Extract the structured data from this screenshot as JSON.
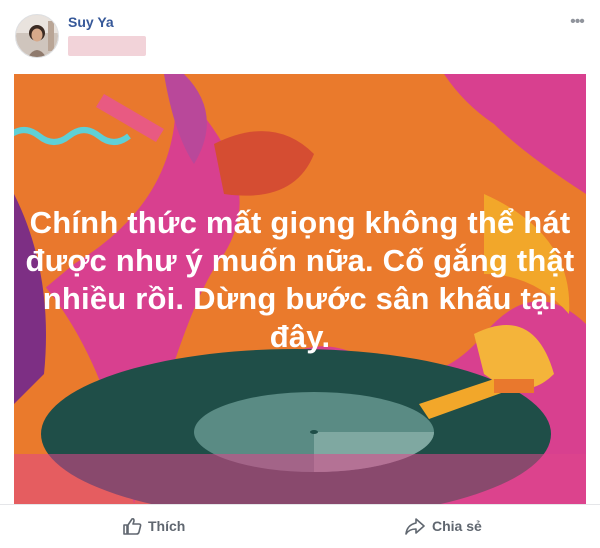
{
  "post": {
    "author_name": "Suy Ya",
    "status_text": "Chính thức mất giọng không thể hát được như ý muốn nữa. Cố gắng thật nhiều rồi. Dừng bước sân khấu tại đây."
  },
  "actions": {
    "like_label": "Thích",
    "share_label": "Chia sẻ"
  },
  "icons": {
    "more": "more-options-icon",
    "like": "thumbs-up-icon",
    "share": "share-arrow-icon"
  },
  "colors": {
    "author": "#365899",
    "action_text": "#606770",
    "bg_magenta": "#d8408f",
    "bg_orange": "#e9782d",
    "record": "#1f4e48",
    "text": "#ffffff"
  }
}
